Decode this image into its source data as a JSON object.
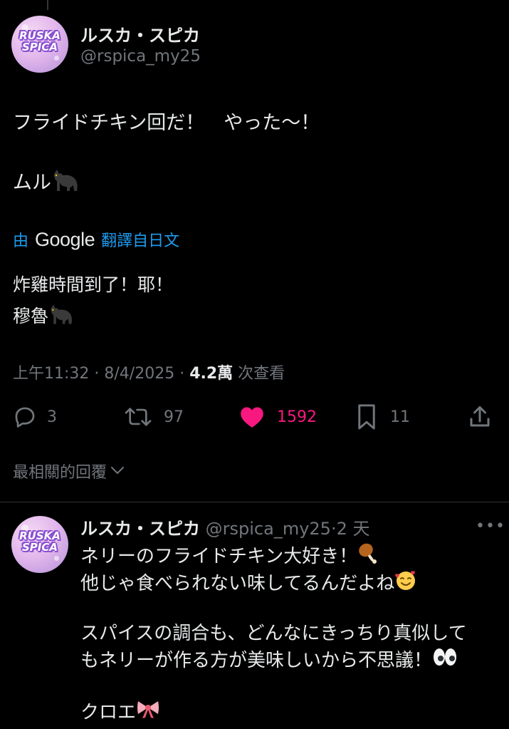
{
  "post": {
    "author_name": "ルスカ・スピカ",
    "handle": "@rspica_my25",
    "avatar_logo_line1": "RUSKA",
    "avatar_logo_line2": "SPICA",
    "text_line1": "フライドチキン回だ！　やった〜！",
    "text_line2": "ムル",
    "translate_prefix": "由",
    "translate_brand": "Google",
    "translate_suffix": "翻譯自日文",
    "translated_line1": "炸雞時間到了！耶！",
    "translated_line2": "穆魯",
    "time": "上午11:32",
    "date": "8/4/2025",
    "views_count": "4.2萬",
    "views_label": "次查看",
    "separator": " · "
  },
  "actions": {
    "replies": "3",
    "reposts": "97",
    "likes": "1592",
    "bookmarks": "11",
    "icons": [
      "reply-icon",
      "repost-icon",
      "heart-icon",
      "bookmark-icon",
      "share-icon"
    ],
    "like_color": "#f91880"
  },
  "sort": {
    "label": "最相關的回覆"
  },
  "reply": {
    "author_name": "ルスカ・スピカ",
    "handle": "@rspica_my25",
    "age": "2 天",
    "separator": "·",
    "more": "•••",
    "line1": "ネリーのフライドチキン大好き！",
    "line2": "他じゃ食べられない味してるんだよね",
    "line3": "スパイスの調合も、どんなにきっちり真似して",
    "line4": "もネリーが作る方が美味しいから不思議！",
    "line5": "クロエ"
  },
  "colors": {
    "background": "#000000",
    "text": "#e7e9ea",
    "muted": "#71767b",
    "link": "#1d9bf0",
    "like": "#f91880"
  }
}
